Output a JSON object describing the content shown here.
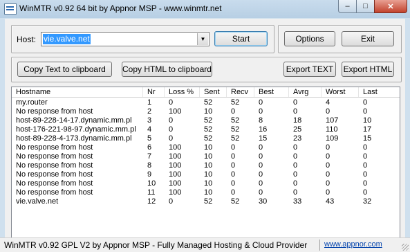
{
  "window": {
    "title": "WinMTR v0.92 64 bit by Appnor MSP - www.winmtr.net",
    "minimize_glyph": "–",
    "maximize_glyph": "□",
    "close_glyph": "✕"
  },
  "controls": {
    "host_label": "Host:",
    "host_value": "vie.valve.net",
    "start_label": "Start",
    "options_label": "Options",
    "exit_label": "Exit",
    "copy_text_label": "Copy Text to clipboard",
    "copy_html_label": "Copy HTML to clipboard",
    "export_text_label": "Export TEXT",
    "export_html_label": "Export HTML"
  },
  "table": {
    "headers": [
      "Hostname",
      "Nr",
      "Loss %",
      "Sent",
      "Recv",
      "Best",
      "Avrg",
      "Worst",
      "Last"
    ],
    "rows": [
      [
        "my.router",
        "1",
        "0",
        "52",
        "52",
        "0",
        "0",
        "4",
        "0"
      ],
      [
        "No response from host",
        "2",
        "100",
        "10",
        "0",
        "0",
        "0",
        "0",
        "0"
      ],
      [
        "host-89-228-14-17.dynamic.mm.pl",
        "3",
        "0",
        "52",
        "52",
        "8",
        "18",
        "107",
        "10"
      ],
      [
        "host-176-221-98-97.dynamic.mm.pl",
        "4",
        "0",
        "52",
        "52",
        "16",
        "25",
        "110",
        "17"
      ],
      [
        "host-89-228-4-173.dynamic.mm.pl",
        "5",
        "0",
        "52",
        "52",
        "15",
        "23",
        "109",
        "15"
      ],
      [
        "No response from host",
        "6",
        "100",
        "10",
        "0",
        "0",
        "0",
        "0",
        "0"
      ],
      [
        "No response from host",
        "7",
        "100",
        "10",
        "0",
        "0",
        "0",
        "0",
        "0"
      ],
      [
        "No response from host",
        "8",
        "100",
        "10",
        "0",
        "0",
        "0",
        "0",
        "0"
      ],
      [
        "No response from host",
        "9",
        "100",
        "10",
        "0",
        "0",
        "0",
        "0",
        "0"
      ],
      [
        "No response from host",
        "10",
        "100",
        "10",
        "0",
        "0",
        "0",
        "0",
        "0"
      ],
      [
        "No response from host",
        "11",
        "100",
        "10",
        "0",
        "0",
        "0",
        "0",
        "0"
      ],
      [
        "vie.valve.net",
        "12",
        "0",
        "52",
        "52",
        "30",
        "33",
        "43",
        "32"
      ]
    ]
  },
  "statusbar": {
    "text": "WinMTR v0.92 GPL V2 by Appnor MSP - Fully Managed Hosting & Cloud Provider",
    "link": "www.appnor.com"
  }
}
